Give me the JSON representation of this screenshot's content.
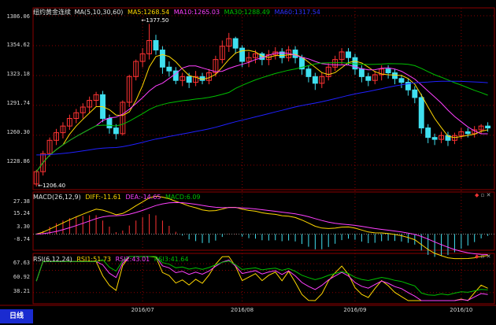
{
  "main_legend": {
    "name": "纽约黄金连续",
    "indicator": "MA(5,10,30,60)",
    "ma5": "MA5:1268.54",
    "ma10": "MA10:1265.03",
    "ma30": "MA30:1288.49",
    "ma60": "MA60:1317.54"
  },
  "macd_legend": {
    "name": "MACD(26,12,9)",
    "diff": "DIFF:-11.61",
    "dea": "DEA:-14.65",
    "macd": "MACD:6.09"
  },
  "rsi_legend": {
    "name": "RSI(6,12,24)",
    "rsi1": "RSI1:51.73",
    "rsi2": "RSI2:43.01",
    "rsi3": "RSI3:41.64"
  },
  "annotations": {
    "high": "1377.50",
    "low": "1206.40"
  },
  "mode_tab": "日线",
  "colors": {
    "background": "#000000",
    "up_candle": "#ff3333",
    "down_candle": "#40e0f0",
    "ma5": "#ffd700",
    "ma10": "#ff40ff",
    "ma30": "#00c000",
    "ma60": "#2020ff",
    "grid": "#8b0000",
    "axis_text": "#d8d8d8"
  },
  "chart_data": [
    {
      "type": "candlestick",
      "ylim": [
        1206.4,
        1386.06
      ],
      "y_ticks": [
        "1386.06",
        "1354.62",
        "1323.18",
        "1291.74",
        "1260.30",
        "1228.86"
      ],
      "x_ticks": [
        "2016/07",
        "2016/08",
        "2016/09",
        "2016/10"
      ],
      "x_tick_bars": [
        16,
        31,
        48,
        64
      ],
      "high_label_bar": 17,
      "low_label_bar": 0,
      "candles": [
        [
          1209,
          1222,
          1206.4,
          1224
        ],
        [
          1222,
          1241,
          1218,
          1244
        ],
        [
          1241,
          1255,
          1238,
          1258
        ],
        [
          1255,
          1263,
          1250,
          1267
        ],
        [
          1263,
          1270,
          1257,
          1274
        ],
        [
          1270,
          1278,
          1266,
          1282
        ],
        [
          1278,
          1284,
          1273,
          1288
        ],
        [
          1284,
          1290,
          1278,
          1294
        ],
        [
          1290,
          1297,
          1284,
          1301
        ],
        [
          1297,
          1303,
          1291,
          1306
        ],
        [
          1303,
          1278,
          1274,
          1307
        ],
        [
          1278,
          1268,
          1262,
          1282
        ],
        [
          1268,
          1262,
          1256,
          1272
        ],
        [
          1262,
          1295,
          1260,
          1297
        ],
        [
          1295,
          1322,
          1290,
          1324
        ],
        [
          1322,
          1338,
          1318,
          1340
        ],
        [
          1338,
          1346,
          1332,
          1352
        ],
        [
          1346,
          1360,
          1340,
          1377.5
        ],
        [
          1360,
          1350,
          1345,
          1366
        ],
        [
          1350,
          1332,
          1325,
          1354
        ],
        [
          1332,
          1328,
          1322,
          1338
        ],
        [
          1328,
          1318,
          1314,
          1332
        ],
        [
          1318,
          1322,
          1312,
          1326
        ],
        [
          1322,
          1316,
          1310,
          1326
        ],
        [
          1316,
          1322,
          1312,
          1328
        ],
        [
          1322,
          1318,
          1314,
          1326
        ],
        [
          1318,
          1326,
          1314,
          1330
        ],
        [
          1326,
          1340,
          1322,
          1344
        ],
        [
          1340,
          1354,
          1336,
          1360
        ],
        [
          1354,
          1362,
          1348,
          1368
        ],
        [
          1362,
          1352,
          1346,
          1364
        ],
        [
          1352,
          1338,
          1332,
          1355
        ],
        [
          1338,
          1342,
          1332,
          1348
        ],
        [
          1342,
          1346,
          1336,
          1350
        ],
        [
          1346,
          1340,
          1334,
          1348
        ],
        [
          1340,
          1345,
          1334,
          1350
        ],
        [
          1345,
          1348,
          1340,
          1353
        ],
        [
          1348,
          1342,
          1336,
          1352
        ],
        [
          1342,
          1350,
          1338,
          1354
        ],
        [
          1350,
          1342,
          1336,
          1354
        ],
        [
          1342,
          1330,
          1324,
          1345
        ],
        [
          1330,
          1322,
          1316,
          1334
        ],
        [
          1322,
          1315,
          1308,
          1326
        ],
        [
          1315,
          1322,
          1310,
          1326
        ],
        [
          1322,
          1332,
          1318,
          1336
        ],
        [
          1332,
          1340,
          1328,
          1344
        ],
        [
          1340,
          1348,
          1335,
          1352
        ],
        [
          1348,
          1342,
          1334,
          1352
        ],
        [
          1342,
          1330,
          1324,
          1346
        ],
        [
          1330,
          1322,
          1316,
          1334
        ],
        [
          1322,
          1318,
          1312,
          1326
        ],
        [
          1318,
          1324,
          1314,
          1328
        ],
        [
          1324,
          1330,
          1318,
          1334
        ],
        [
          1330,
          1326,
          1320,
          1334
        ],
        [
          1326,
          1320,
          1314,
          1330
        ],
        [
          1320,
          1316,
          1310,
          1324
        ],
        [
          1316,
          1308,
          1302,
          1320
        ],
        [
          1308,
          1300,
          1294,
          1312
        ],
        [
          1300,
          1268,
          1262,
          1304
        ],
        [
          1268,
          1258,
          1252,
          1272
        ],
        [
          1258,
          1256,
          1250,
          1262
        ],
        [
          1256,
          1260,
          1252,
          1264
        ],
        [
          1260,
          1255,
          1249,
          1264
        ],
        [
          1255,
          1260,
          1251,
          1263
        ],
        [
          1260,
          1264,
          1256,
          1268
        ],
        [
          1264,
          1262,
          1258,
          1268
        ],
        [
          1262,
          1266,
          1258,
          1270
        ],
        [
          1266,
          1270,
          1262,
          1272
        ],
        [
          1270,
          1268,
          1264,
          1274
        ]
      ]
    },
    {
      "type": "bar+line",
      "name": "MACD",
      "y_ticks": [
        "27.38",
        "15.24",
        "3.30",
        "-8.74"
      ],
      "ylim": [
        -8.74,
        27.38
      ]
    },
    {
      "type": "line",
      "name": "RSI",
      "y_ticks": [
        "67.63",
        "60.92",
        "38.21"
      ],
      "ylim": [
        30,
        75
      ]
    }
  ]
}
